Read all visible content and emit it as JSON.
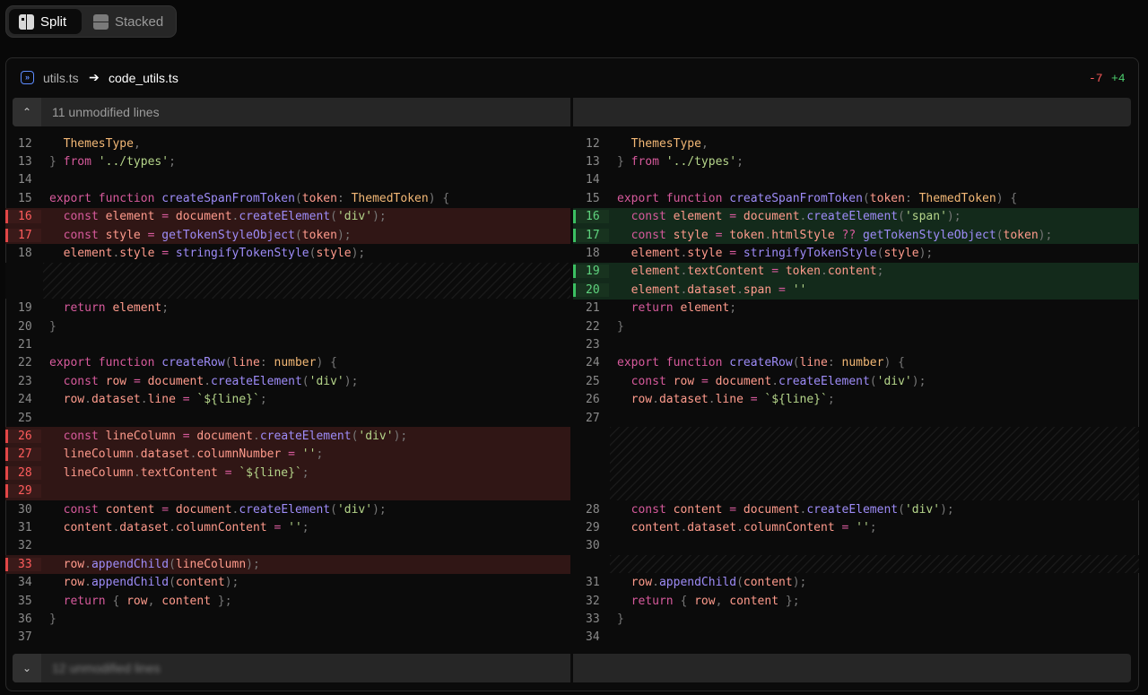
{
  "toggle": {
    "split_label": "Split",
    "stacked_label": "Stacked"
  },
  "file": {
    "old_name": "utils.ts",
    "new_name": "code_utils.ts",
    "arrow": "➔",
    "deletions": "-7",
    "additions": "+4"
  },
  "separators": {
    "top_text": "11 unmodified lines",
    "bottom_text": "12 unmodified lines"
  },
  "colors": {
    "deletion": "#ff5c5c",
    "addition": "#5fd37e",
    "accent": "#5d8cff"
  },
  "icons": {
    "split": "split-view-icon",
    "stacked": "stacked-view-icon",
    "file": "diff-file-icon",
    "collapse": "chevron-up-icon",
    "expand": "chevron-down-icon"
  },
  "left_lines": [
    {
      "n": "12",
      "type": "ctx",
      "code": "  ThemesType,"
    },
    {
      "n": "13",
      "type": "ctx",
      "code": "} from '../types';"
    },
    {
      "n": "14",
      "type": "ctx",
      "code": ""
    },
    {
      "n": "15",
      "type": "ctx",
      "code": "export function createSpanFromToken(token: ThemedToken) {"
    },
    {
      "n": "16",
      "type": "del",
      "code": "  const element = document.createElement('div');"
    },
    {
      "n": "17",
      "type": "del",
      "code": "  const style = getTokenStyleObject(token);"
    },
    {
      "n": "18",
      "type": "ctx",
      "code": "  element.style = stringifyTokenStyle(style);"
    },
    {
      "n": "19",
      "type": "ctx",
      "code": "  return element;"
    },
    {
      "n": "20",
      "type": "ctx",
      "code": "}"
    },
    {
      "n": "21",
      "type": "ctx",
      "code": ""
    },
    {
      "n": "22",
      "type": "ctx",
      "code": "export function createRow(line: number) {"
    },
    {
      "n": "23",
      "type": "ctx",
      "code": "  const row = document.createElement('div');"
    },
    {
      "n": "24",
      "type": "ctx",
      "code": "  row.dataset.line = `${line}`;"
    },
    {
      "n": "25",
      "type": "ctx",
      "code": ""
    },
    {
      "n": "26",
      "type": "del",
      "code": "  const lineColumn = document.createElement('div');"
    },
    {
      "n": "27",
      "type": "del",
      "code": "  lineColumn.dataset.columnNumber = '';"
    },
    {
      "n": "28",
      "type": "del",
      "code": "  lineColumn.textContent = `${line}`;"
    },
    {
      "n": "29",
      "type": "del",
      "code": ""
    },
    {
      "n": "30",
      "type": "ctx",
      "code": "  const content = document.createElement('div');"
    },
    {
      "n": "31",
      "type": "ctx",
      "code": "  content.dataset.columnContent = '';"
    },
    {
      "n": "32",
      "type": "ctx",
      "code": ""
    },
    {
      "n": "33",
      "type": "del",
      "code": "  row.appendChild(lineColumn);"
    },
    {
      "n": "34",
      "type": "ctx",
      "code": "  row.appendChild(content);"
    },
    {
      "n": "35",
      "type": "ctx",
      "code": "  return { row, content };"
    },
    {
      "n": "36",
      "type": "ctx",
      "code": "}"
    },
    {
      "n": "37",
      "type": "ctx",
      "code": ""
    }
  ],
  "right_lines": [
    {
      "n": "12",
      "type": "ctx",
      "code": "  ThemesType,"
    },
    {
      "n": "13",
      "type": "ctx",
      "code": "} from '../types';"
    },
    {
      "n": "14",
      "type": "ctx",
      "code": ""
    },
    {
      "n": "15",
      "type": "ctx",
      "code": "export function createSpanFromToken(token: ThemedToken) {"
    },
    {
      "n": "16",
      "type": "add",
      "code": "  const element = document.createElement('span');"
    },
    {
      "n": "17",
      "type": "add",
      "code": "  const style = token.htmlStyle ?? getTokenStyleObject(token);"
    },
    {
      "n": "18",
      "type": "ctx",
      "code": "  element.style = stringifyTokenStyle(style);"
    },
    {
      "n": "19",
      "type": "add",
      "code": "  element.textContent = token.content;"
    },
    {
      "n": "20",
      "type": "add",
      "code": "  element.dataset.span = ''"
    },
    {
      "n": "21",
      "type": "ctx",
      "code": "  return element;"
    },
    {
      "n": "22",
      "type": "ctx",
      "code": "}"
    },
    {
      "n": "23",
      "type": "ctx",
      "code": ""
    },
    {
      "n": "24",
      "type": "ctx",
      "code": "export function createRow(line: number) {"
    },
    {
      "n": "25",
      "type": "ctx",
      "code": "  const row = document.createElement('div');"
    },
    {
      "n": "26",
      "type": "ctx",
      "code": "  row.dataset.line = `${line}`;"
    },
    {
      "n": "27",
      "type": "ctx",
      "code": ""
    },
    {
      "n": "28",
      "type": "ctx",
      "code": "  const content = document.createElement('div');"
    },
    {
      "n": "29",
      "type": "ctx",
      "code": "  content.dataset.columnContent = '';"
    },
    {
      "n": "30",
      "type": "ctx",
      "code": ""
    },
    {
      "n": "31",
      "type": "ctx",
      "code": "  row.appendChild(content);"
    },
    {
      "n": "32",
      "type": "ctx",
      "code": "  return { row, content };"
    },
    {
      "n": "33",
      "type": "ctx",
      "code": "}"
    },
    {
      "n": "34",
      "type": "ctx",
      "code": ""
    }
  ]
}
